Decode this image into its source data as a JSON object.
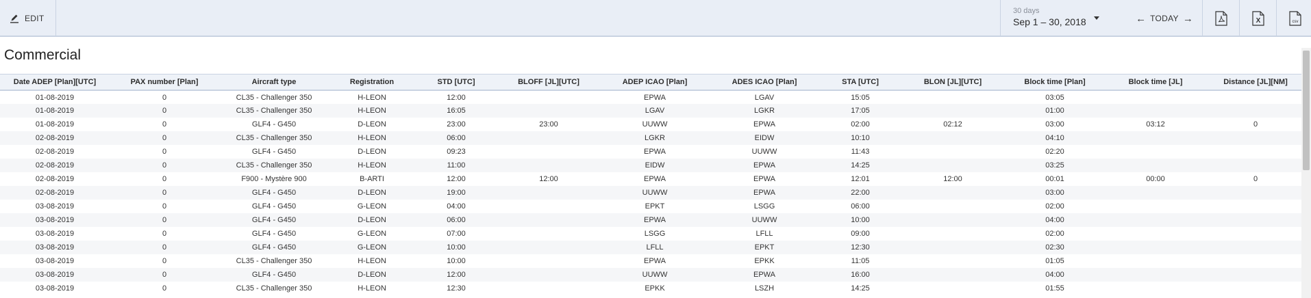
{
  "toolbar": {
    "edit_label": "EDIT",
    "range_caption": "30 days",
    "range_value": "Sep 1 – 30, 2018",
    "today_label": "TODAY",
    "prev_arrow": "←",
    "next_arrow": "→",
    "export_icons": [
      "pdf-icon",
      "excel-icon",
      "csv-icon"
    ],
    "export_badges": {
      "excel": "X",
      "csv": "csv"
    }
  },
  "section": {
    "title": "Commercial"
  },
  "table": {
    "columns": [
      "Date ADEP [Plan][UTC]",
      "PAX number [Plan]",
      "Aircraft type",
      "Registration",
      "STD [UTC]",
      "BLOFF [JL][UTC]",
      "ADEP ICAO [Plan]",
      "ADES ICAO [Plan]",
      "STA [UTC]",
      "BLON [JL][UTC]",
      "Block time [Plan]",
      "Block time [JL]",
      "Distance [JL][NM]"
    ],
    "rows": [
      [
        "01-08-2019",
        "0",
        "CL35 - Challenger 350",
        "H-LEON",
        "12:00",
        "",
        "EPWA",
        "LGAV",
        "15:05",
        "",
        "03:05",
        "",
        ""
      ],
      [
        "01-08-2019",
        "0",
        "CL35 - Challenger 350",
        "H-LEON",
        "16:05",
        "",
        "LGAV",
        "LGKR",
        "17:05",
        "",
        "01:00",
        "",
        ""
      ],
      [
        "01-08-2019",
        "0",
        "GLF4 - G450",
        "D-LEON",
        "23:00",
        "23:00",
        "UUWW",
        "EPWA",
        "02:00",
        "02:12",
        "03:00",
        "03:12",
        "0"
      ],
      [
        "02-08-2019",
        "0",
        "CL35 - Challenger 350",
        "H-LEON",
        "06:00",
        "",
        "LGKR",
        "EIDW",
        "10:10",
        "",
        "04:10",
        "",
        ""
      ],
      [
        "02-08-2019",
        "0",
        "GLF4 - G450",
        "D-LEON",
        "09:23",
        "",
        "EPWA",
        "UUWW",
        "11:43",
        "",
        "02:20",
        "",
        ""
      ],
      [
        "02-08-2019",
        "0",
        "CL35 - Challenger 350",
        "H-LEON",
        "11:00",
        "",
        "EIDW",
        "EPWA",
        "14:25",
        "",
        "03:25",
        "",
        ""
      ],
      [
        "02-08-2019",
        "0",
        "F900 - Mystère 900",
        "B-ARTI",
        "12:00",
        "12:00",
        "EPWA",
        "EPWA",
        "12:01",
        "12:00",
        "00:01",
        "00:00",
        "0"
      ],
      [
        "02-08-2019",
        "0",
        "GLF4 - G450",
        "D-LEON",
        "19:00",
        "",
        "UUWW",
        "EPWA",
        "22:00",
        "",
        "03:00",
        "",
        ""
      ],
      [
        "03-08-2019",
        "0",
        "GLF4 - G450",
        "G-LEON",
        "04:00",
        "",
        "EPKT",
        "LSGG",
        "06:00",
        "",
        "02:00",
        "",
        ""
      ],
      [
        "03-08-2019",
        "0",
        "GLF4 - G450",
        "D-LEON",
        "06:00",
        "",
        "EPWA",
        "UUWW",
        "10:00",
        "",
        "04:00",
        "",
        ""
      ],
      [
        "03-08-2019",
        "0",
        "GLF4 - G450",
        "G-LEON",
        "07:00",
        "",
        "LSGG",
        "LFLL",
        "09:00",
        "",
        "02:00",
        "",
        ""
      ],
      [
        "03-08-2019",
        "0",
        "GLF4 - G450",
        "G-LEON",
        "10:00",
        "",
        "LFLL",
        "EPKT",
        "12:30",
        "",
        "02:30",
        "",
        ""
      ],
      [
        "03-08-2019",
        "0",
        "CL35 - Challenger 350",
        "H-LEON",
        "10:00",
        "",
        "EPWA",
        "EPKK",
        "11:05",
        "",
        "01:05",
        "",
        ""
      ],
      [
        "03-08-2019",
        "0",
        "GLF4 - G450",
        "D-LEON",
        "12:00",
        "",
        "UUWW",
        "EPWA",
        "16:00",
        "",
        "04:00",
        "",
        ""
      ],
      [
        "03-08-2019",
        "0",
        "CL35 - Challenger 350",
        "H-LEON",
        "12:30",
        "",
        "EPKK",
        "LSZH",
        "14:25",
        "",
        "01:55",
        "",
        ""
      ]
    ]
  }
}
